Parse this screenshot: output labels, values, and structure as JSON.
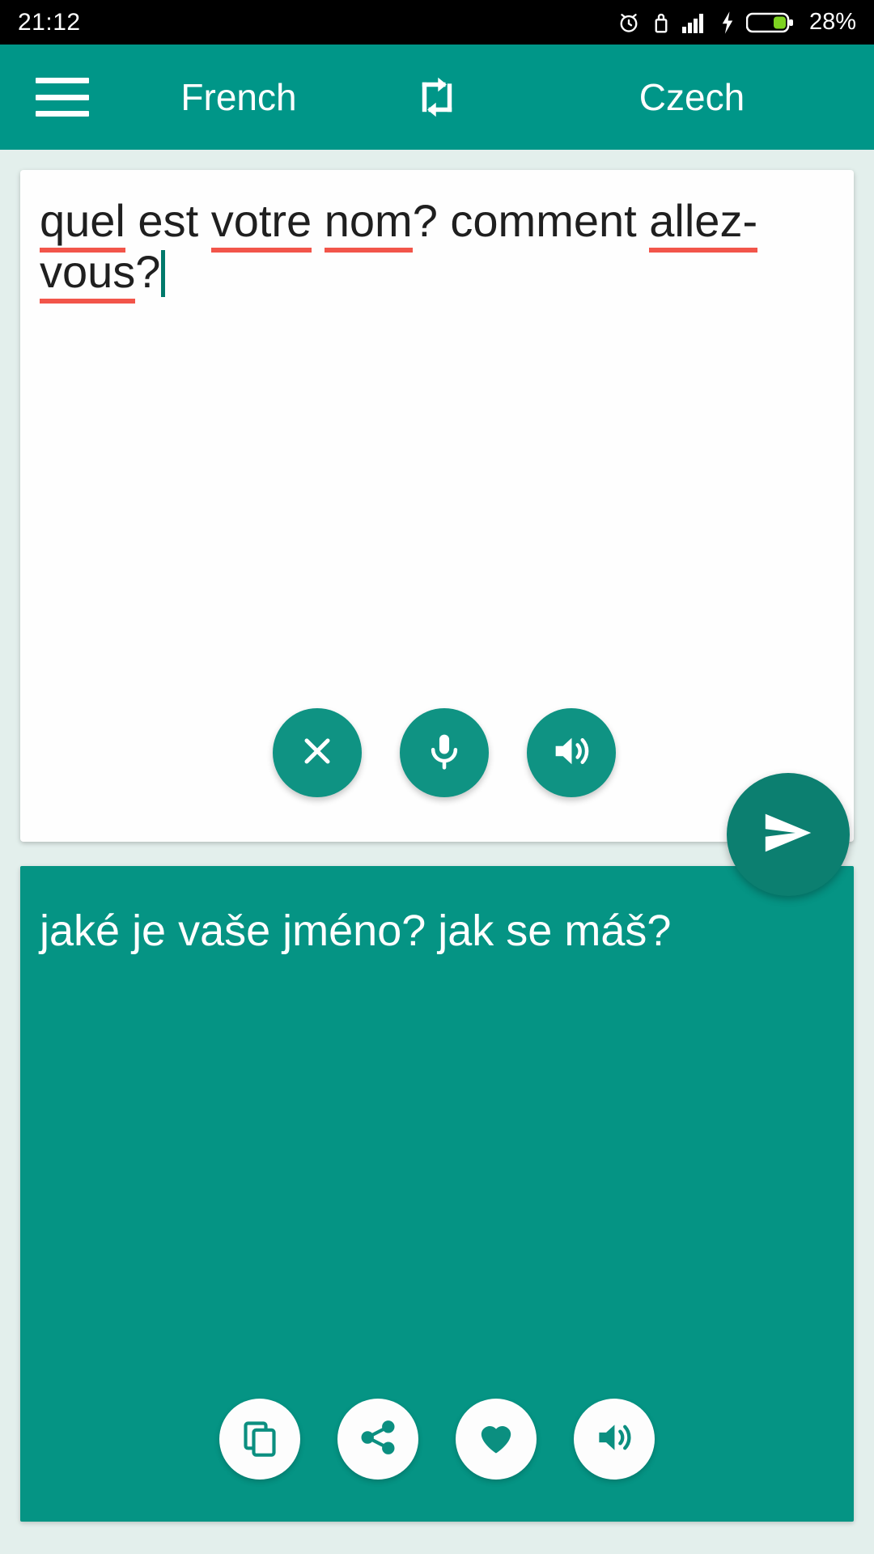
{
  "status_bar": {
    "time": "21:12",
    "battery_percent": "28%",
    "icons": [
      "alarm-icon",
      "lock-icon",
      "signal-icon",
      "charging-bolt-icon",
      "battery-icon"
    ]
  },
  "app_bar": {
    "menu_icon": "hamburger-menu-icon",
    "source_language": "French",
    "swap_icon": "swap-languages-icon",
    "target_language": "Czech"
  },
  "input_card": {
    "text_segments": [
      {
        "text": "quel",
        "misspelled": true
      },
      {
        "text": " est ",
        "misspelled": false
      },
      {
        "text": "votre",
        "misspelled": true
      },
      {
        "text": " ",
        "misspelled": false
      },
      {
        "text": "nom",
        "misspelled": true
      },
      {
        "text": "? comment ",
        "misspelled": false
      },
      {
        "text": "allez-vous",
        "misspelled": true
      },
      {
        "text": "?",
        "misspelled": false
      }
    ],
    "full_text": "quel est votre nom? comment allez-vous?",
    "actions": [
      {
        "name": "clear-button",
        "icon": "close-icon"
      },
      {
        "name": "microphone-button",
        "icon": "microphone-icon"
      },
      {
        "name": "speak-source-button",
        "icon": "speaker-icon"
      }
    ]
  },
  "send_button": {
    "name": "send-button",
    "icon": "send-icon"
  },
  "output_card": {
    "text": "jaké je vaše jméno? jak se máš?",
    "actions": [
      {
        "name": "copy-button",
        "icon": "copy-icon"
      },
      {
        "name": "share-button",
        "icon": "share-icon"
      },
      {
        "name": "favorite-button",
        "icon": "heart-icon"
      },
      {
        "name": "speak-translation-button",
        "icon": "speaker-icon"
      }
    ]
  },
  "colors": {
    "app_bar": "#009688",
    "accent": "#0f9383",
    "output_card": "#059484",
    "fab": "#0c7f70",
    "page_background": "#e3efec",
    "spellcheck_underline": "#f2554a",
    "battery_fill": "#7ed321"
  }
}
